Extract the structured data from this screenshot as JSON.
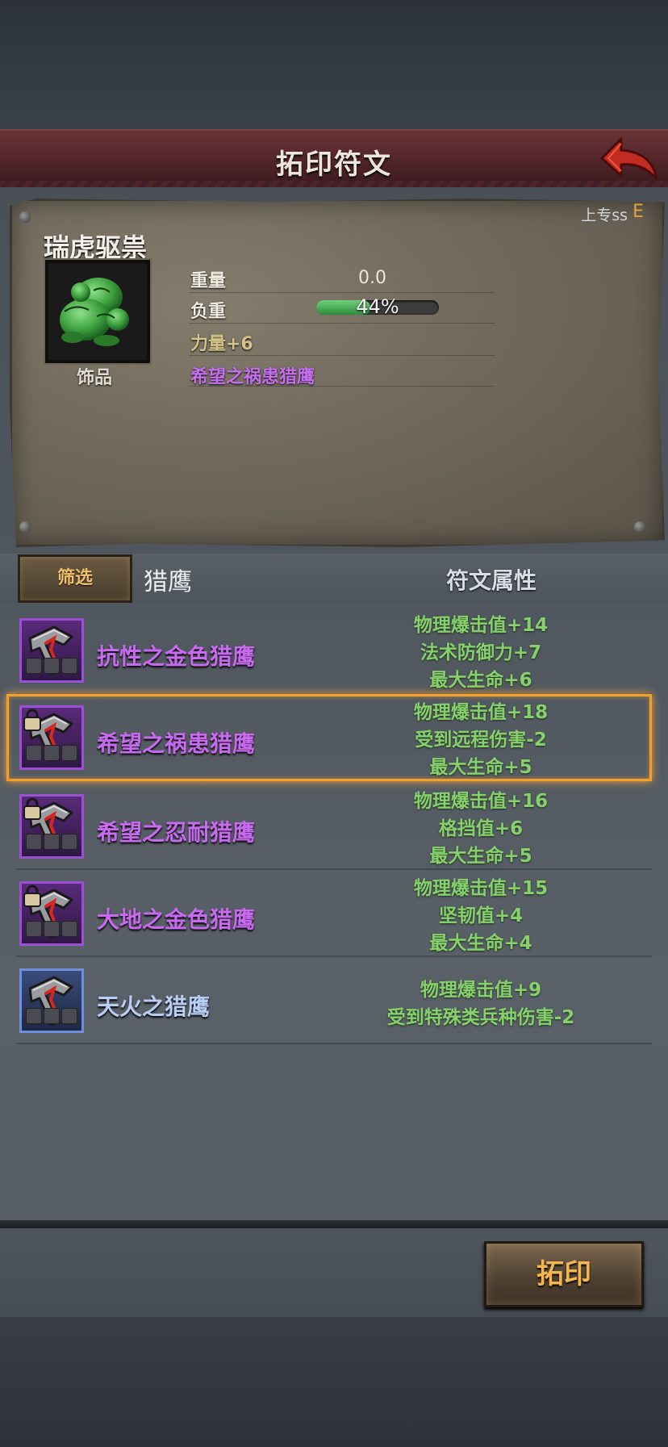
{
  "header": {
    "title": "拓印符文"
  },
  "item": {
    "rank_label": "上专ss",
    "rank_grade": "E",
    "name": "瑞虎驱祟",
    "type": "饰品",
    "stats": {
      "weight_label": "重量",
      "weight_value": "0.0",
      "load_label": "负重",
      "load_percent": 44,
      "load_text": "44%",
      "strength": "力量+6",
      "rune": "希望之祸患猎鹰"
    }
  },
  "filter": {
    "button_label": "筛选",
    "current": "猎鹰",
    "attr_header": "符文属性"
  },
  "runes": [
    {
      "name": "抗性之金色猎鹰",
      "locked": false,
      "rarity": "purple",
      "stats": [
        "物理爆击值+14",
        "法术防御力+7",
        "最大生命+6"
      ]
    },
    {
      "name": "希望之祸患猎鹰",
      "locked": true,
      "rarity": "purple",
      "stats": [
        "物理爆击值+18",
        "受到远程伤害-2",
        "最大生命+5"
      ]
    },
    {
      "name": "希望之忍耐猎鹰",
      "locked": true,
      "rarity": "purple",
      "stats": [
        "物理爆击值+16",
        "格挡值+6",
        "最大生命+5"
      ]
    },
    {
      "name": "大地之金色猎鹰",
      "locked": true,
      "rarity": "purple",
      "stats": [
        "物理爆击值+15",
        "坚韧值+4",
        "最大生命+4"
      ]
    },
    {
      "name": "天火之猎鹰",
      "locked": false,
      "rarity": "blue",
      "stats": [
        "物理爆击值+9",
        "受到特殊类兵种伤害-2"
      ]
    }
  ],
  "actions": {
    "imprint_label": "拓印"
  },
  "colors": {
    "accent": "#f2a02a",
    "purple_name": "#c86af0",
    "stat_green": "#86d16e",
    "title_red": "#4f2428"
  }
}
